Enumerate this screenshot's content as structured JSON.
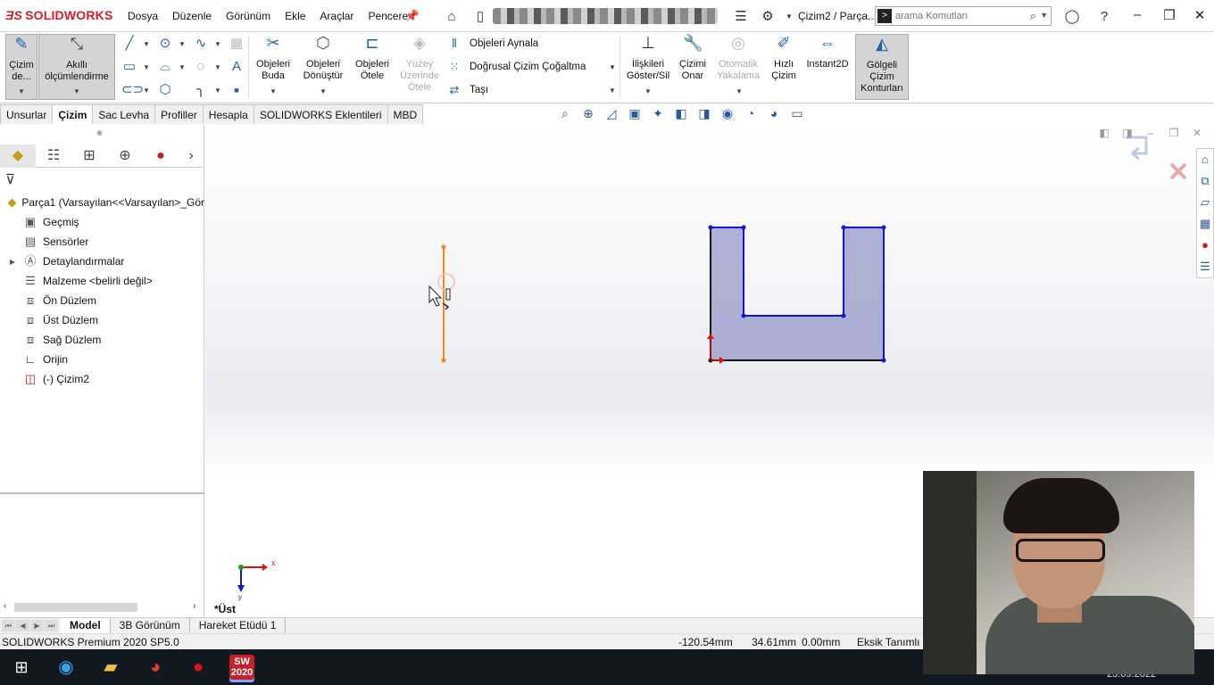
{
  "app": {
    "logo": "SOLIDWORKS",
    "logo_mark": "ƎS"
  },
  "menu": [
    "Dosya",
    "Düzenle",
    "Görünüm",
    "Ekle",
    "Araçlar",
    "Pencere"
  ],
  "title": {
    "document": "Çizim2 / Parça..."
  },
  "search": {
    "placeholder": "arama Komutları"
  },
  "ribbon": {
    "cizim": "Çizim de...",
    "akilli": "Akıllı ölçümlendirme",
    "buda": "Objeleri Buda",
    "donustur": "Objeleri Dönüştür",
    "otele": "Objeleri Ötele",
    "yuzey": "Yüzey Üzerinde Ötele",
    "aynala": "Objeleri Aynala",
    "cogaltma": "Doğrusal Çizim Çoğaltma",
    "tasi": "Taşı",
    "iliskiler": "İlişkileri Göster/Sil",
    "onar": "Çizimi Onar",
    "yakalama": "Otomatik Yakalama",
    "hizli": "Hızlı Çizim",
    "instant": "Instant2D",
    "golgeli": "Gölgeli Çizim Konturları"
  },
  "command_tabs": [
    {
      "label": "Unsurlar",
      "active": false
    },
    {
      "label": "Çizim",
      "active": true
    },
    {
      "label": "Sac Levha",
      "active": false
    },
    {
      "label": "Profiller",
      "active": false
    },
    {
      "label": "Hesapla",
      "active": false
    },
    {
      "label": "SOLIDWORKS Eklentileri",
      "active": false
    },
    {
      "label": "MBD",
      "active": false
    }
  ],
  "tree": {
    "root": "Parça1  (Varsayılan<<Varsayılan>_Gör",
    "items": [
      "Geçmiş",
      "Sensörler",
      "Detaylandırmalar",
      "Malzeme <belirli değil>",
      "Ön Düzlem",
      "Üst Düzlem",
      "Sağ Düzlem",
      "Orijin",
      "(-) Çizim2"
    ]
  },
  "viewport": {
    "view_label": "*Üst",
    "axis_x": "x",
    "axis_y": "y"
  },
  "model_tabs": [
    {
      "label": "Model",
      "active": true
    },
    {
      "label": "3B Görünüm",
      "active": false
    },
    {
      "label": "Hareket Etüdü 1",
      "active": false
    }
  ],
  "status": {
    "product": "SOLIDWORKS Premium 2020 SP5.0",
    "x": "-120.54mm",
    "y": "34.61mm",
    "z": "0.00mm",
    "state": "Eksik Tanımlı"
  },
  "taskbar": {
    "sw_badge": "SW 2020",
    "date": "23.09.2022"
  }
}
